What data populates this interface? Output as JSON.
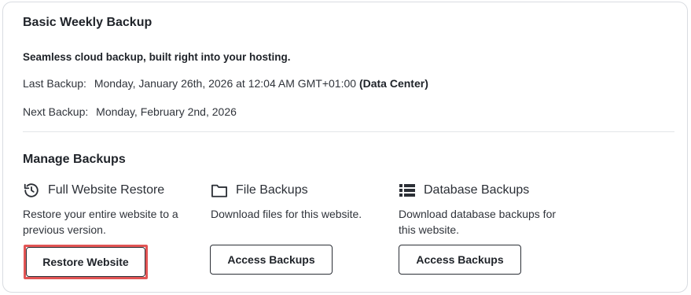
{
  "card": {
    "title": "Basic Weekly Backup",
    "tagline": "Seamless cloud backup, built right into your hosting.",
    "last_backup": {
      "label": "Last Backup:",
      "value": "Monday, January 26th, 2026 at 12:04 AM GMT+01:00",
      "location": "(Data Center)"
    },
    "next_backup": {
      "label": "Next Backup:",
      "value": "Monday, February 2nd, 2026"
    }
  },
  "manage": {
    "title": "Manage Backups",
    "options": [
      {
        "icon": "history-icon",
        "heading": "Full Website Restore",
        "description": "Restore your entire website to a previous version.",
        "button": "Restore Website"
      },
      {
        "icon": "folder-icon",
        "heading": "File Backups",
        "description": "Download files for this website.",
        "button": "Access Backups"
      },
      {
        "icon": "database-list-icon",
        "heading": "Database Backups",
        "description": "Download database backups for this website.",
        "button": "Access Backups"
      }
    ]
  },
  "colors": {
    "text": "#2b2f36",
    "border": "#d9dce1",
    "highlight": "#e25555"
  }
}
